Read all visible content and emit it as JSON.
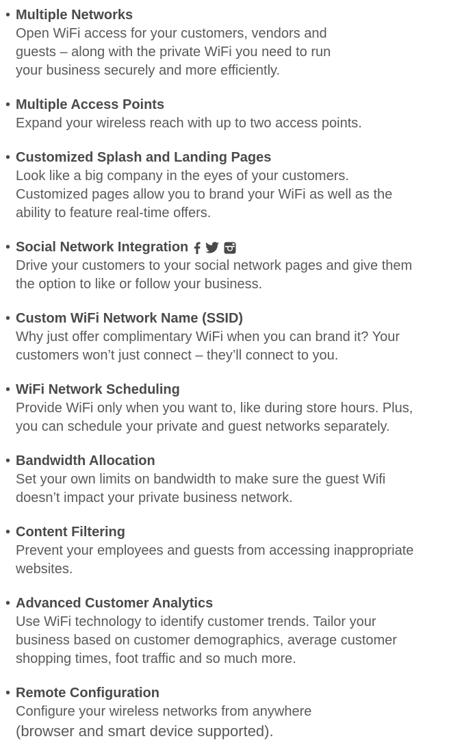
{
  "features": [
    {
      "title": "Multiple Networks",
      "lines": [
        "Open WiFi access for your customers, vendors and",
        "guests – along with the private WiFi you need to run",
        "your business securely and more efficiently."
      ]
    },
    {
      "title": "Multiple Access Points",
      "lines": [
        "Expand your wireless reach with up to two access points."
      ]
    },
    {
      "title": "Customized Splash and Landing Pages",
      "lines": [
        "Look like a big company in the eyes of your customers.",
        "Customized pages allow you to brand your WiFi as well as the",
        "ability to feature real-time offers."
      ]
    },
    {
      "title": "Social Network Integration",
      "icons": [
        "facebook-icon",
        "twitter-icon",
        "instagram-icon"
      ],
      "lines": [
        "Drive your customers to your social network pages and give them",
        "the option to like or follow your business."
      ]
    },
    {
      "title": "Custom WiFi Network Name (SSID)",
      "lines": [
        "Why just offer complimentary WiFi when you can brand it? Your",
        "customers won’t just connect – they’ll connect to you."
      ]
    },
    {
      "title": "WiFi Network Scheduling",
      "lines": [
        "Provide WiFi only when you want to, like during store hours. Plus,",
        "you can schedule your private and guest networks separately."
      ]
    },
    {
      "title": "Bandwidth Allocation",
      "lines": [
        "Set your own limits on bandwidth to make sure the guest Wifi",
        "doesn’t impact your private business network."
      ]
    },
    {
      "title": "Content Filtering",
      "lines": [
        "Prevent your employees and guests from accessing inappropriate",
        "websites."
      ]
    },
    {
      "title": "Advanced Customer Analytics",
      "lines": [
        "Use WiFi technology to identify customer trends. Tailor your",
        "business based on customer demographics, average customer",
        "shopping times, foot traffic and so much more."
      ]
    },
    {
      "title": "Remote Configuration",
      "lines": [
        "Configure your wireless networks from anywhere",
        "(browser and smart device supported)."
      ]
    }
  ],
  "bullet": "•"
}
